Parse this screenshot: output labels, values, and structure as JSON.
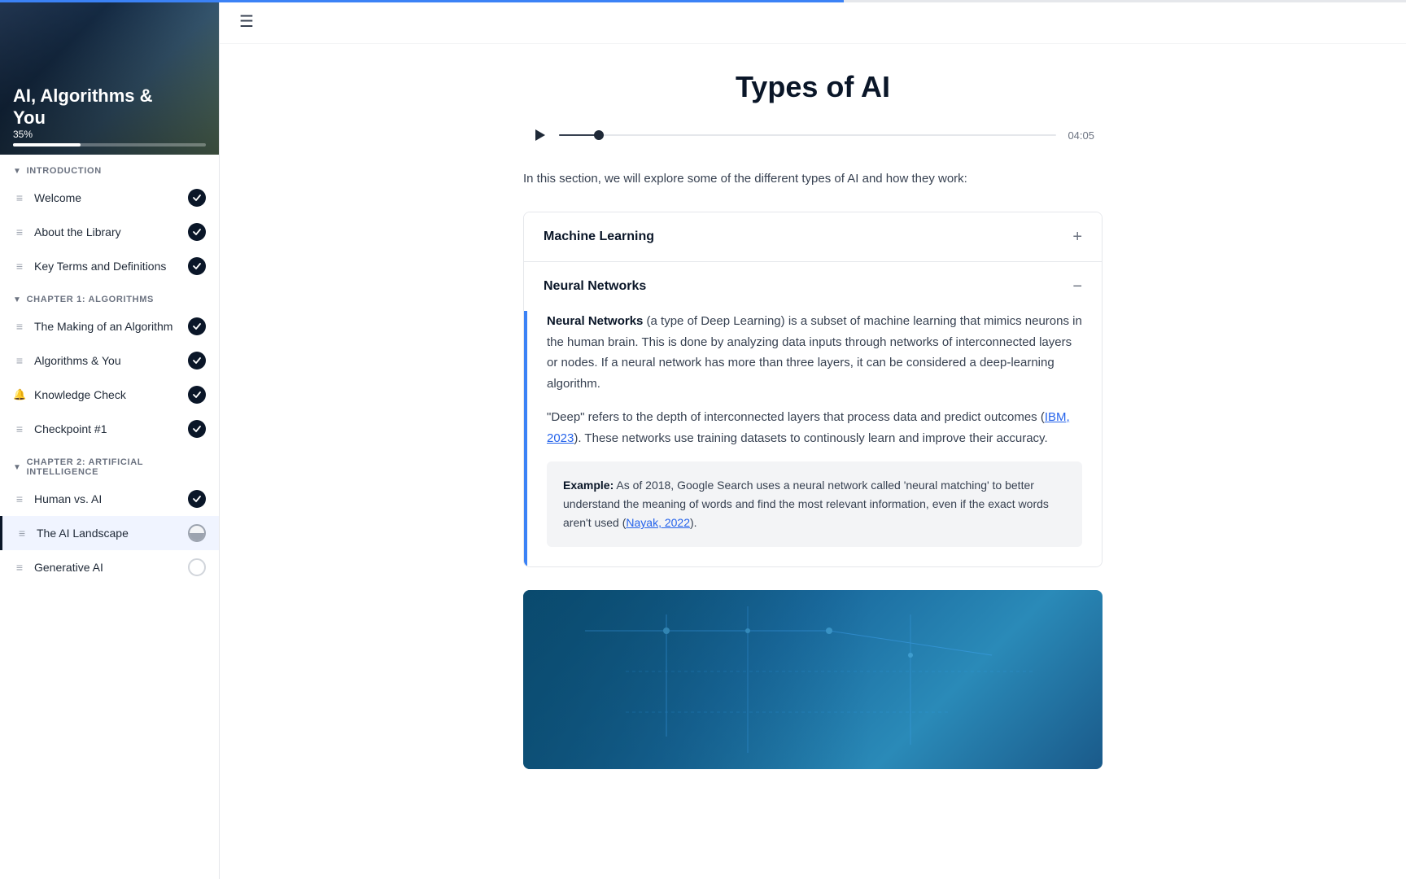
{
  "sidebar": {
    "hero": {
      "title_line1": "AI, Algorithms &",
      "title_line2": "You",
      "progress_label": "35%",
      "progress_percent": 35
    },
    "sections": [
      {
        "id": "introduction",
        "label": "INTRODUCTION",
        "items": [
          {
            "id": "welcome",
            "label": "Welcome",
            "icon": "≡",
            "status": "complete"
          },
          {
            "id": "about-library",
            "label": "About the Library",
            "icon": "≡",
            "status": "complete"
          },
          {
            "id": "key-terms",
            "label": "Key Terms and Definitions",
            "icon": "≡",
            "status": "complete"
          }
        ]
      },
      {
        "id": "chapter1",
        "label": "CHAPTER 1: ALGORITHMS",
        "items": [
          {
            "id": "making-algorithm",
            "label": "The Making of an Algorithm",
            "icon": "≡",
            "status": "complete"
          },
          {
            "id": "algorithms-you",
            "label": "Algorithms & You",
            "icon": "≡",
            "status": "complete"
          },
          {
            "id": "knowledge-check",
            "label": "Knowledge Check",
            "icon": "bell",
            "status": "complete"
          },
          {
            "id": "checkpoint1",
            "label": "Checkpoint #1",
            "icon": "≡",
            "status": "complete"
          }
        ]
      },
      {
        "id": "chapter2",
        "label": "CHAPTER 2: ARTIFICIAL INTELLIGENCE",
        "items": [
          {
            "id": "human-vs-ai",
            "label": "Human vs. AI",
            "icon": "≡",
            "status": "complete"
          },
          {
            "id": "ai-landscape",
            "label": "The AI Landscape",
            "icon": "≡",
            "status": "partial"
          },
          {
            "id": "generative-ai",
            "label": "Generative AI",
            "icon": "≡",
            "status": "empty"
          }
        ]
      }
    ]
  },
  "main": {
    "topbar": {
      "hamburger": "☰"
    },
    "page_title": "Types of AI",
    "audio": {
      "time": "04:05",
      "progress_percent": 8
    },
    "intro_text": "In this section, we will explore some of the different types of AI and how they work:",
    "accordion": [
      {
        "id": "machine-learning",
        "title": "Machine Learning",
        "expanded": false,
        "icon": "+"
      },
      {
        "id": "neural-networks",
        "title": "Neural Networks",
        "expanded": true,
        "icon": "−",
        "paragraphs": [
          {
            "text_before_bold": "",
            "bold": "Neural Networks",
            "text_after_bold": " (a type of Deep Learning) is a subset of machine learning that mimics neurons in the human brain. This is done by analyzing data inputs through networks of interconnected layers or nodes. If a neural network has more than three layers, it can be considered a deep-learning algorithm."
          },
          {
            "text_before_bold": "“Deep” refers to the depth of interconnected layers that process data and predict outcomes (",
            "link_text": "IBM, 2023",
            "text_after_link": "). These networks use training datasets to continously learn and improve their accuracy.",
            "bold": ""
          }
        ],
        "example": {
          "label": "Example:",
          "text": " As of 2018, Google Search uses a neural network called 'neural matching' to better understand the meaning of words and find the most relevant information, even if the exact words aren't used (",
          "link_text": "Nayak, 2022",
          "text_after_link": ")."
        }
      }
    ]
  }
}
